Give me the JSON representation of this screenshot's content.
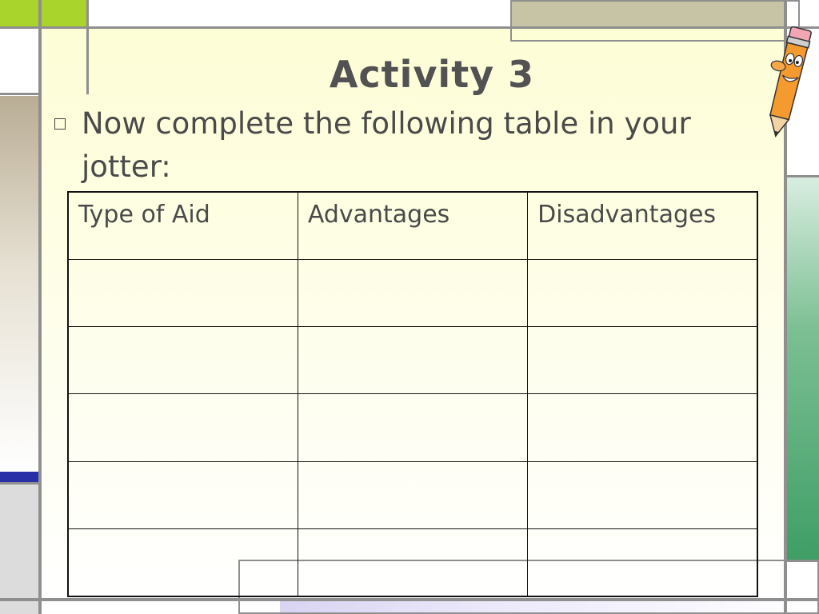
{
  "slide": {
    "title": "Activity 3",
    "bullet": "Now complete the following table in your jotter:"
  },
  "table": {
    "headers": [
      "Type of Aid",
      "Advantages",
      "Disadvantages"
    ],
    "rows": [
      [
        "",
        "",
        ""
      ],
      [
        "",
        "",
        ""
      ],
      [
        "",
        "",
        ""
      ],
      [
        "",
        "",
        ""
      ],
      [
        "",
        "",
        ""
      ]
    ]
  },
  "colors": {
    "slide_background": "#fdfdd6",
    "accent_green_light": "#a8d42c",
    "accent_green_block": "#cfe37a",
    "accent_tan": "#c7c4a6",
    "accent_beige": "#b9ad95",
    "accent_blue": "#2830a8",
    "accent_teal": "#3f9e66",
    "accent_lavender": "#d9d4f2"
  },
  "decorations": {
    "clipart": "pencil-character-icon"
  }
}
